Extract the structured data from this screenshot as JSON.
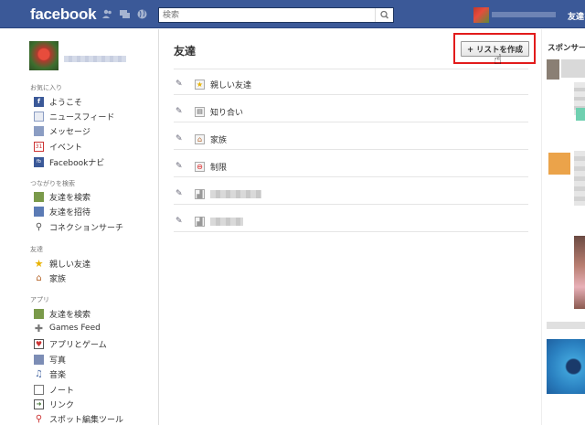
{
  "topbar": {
    "logo": "facebook",
    "search_placeholder": "検索",
    "friends_link": "友達を"
  },
  "sidebar": {
    "sections": [
      {
        "title": "お気に入り",
        "items": [
          {
            "label": "ようこそ",
            "icon": "facebook-f-icon"
          },
          {
            "label": "ニュースフィード",
            "icon": "news-feed-icon"
          },
          {
            "label": "メッセージ",
            "icon": "message-icon"
          },
          {
            "label": "イベント",
            "icon": "calendar-icon"
          },
          {
            "label": "Facebookナビ",
            "icon": "fb-navi-icon"
          }
        ]
      },
      {
        "title": "つながりを検索",
        "items": [
          {
            "label": "友達を検索",
            "icon": "find-friends-icon"
          },
          {
            "label": "友達を招待",
            "icon": "invite-friends-icon"
          },
          {
            "label": "コネクションサーチ",
            "icon": "magnifier-icon"
          }
        ]
      },
      {
        "title": "友達",
        "items": [
          {
            "label": "親しい友達",
            "icon": "star-icon"
          },
          {
            "label": "家族",
            "icon": "house-icon"
          }
        ]
      },
      {
        "title": "アプリ",
        "items": [
          {
            "label": "友達を検索",
            "icon": "find-friends-icon"
          },
          {
            "label": "Games Feed",
            "icon": "games-icon"
          },
          {
            "label": "アプリとゲーム",
            "icon": "apps-icon"
          },
          {
            "label": "写真",
            "icon": "photo-icon"
          },
          {
            "label": "音楽",
            "icon": "music-icon"
          },
          {
            "label": "ノート",
            "icon": "note-icon"
          },
          {
            "label": "リンク",
            "icon": "link-icon"
          },
          {
            "label": "スポット編集ツール",
            "icon": "pin-icon"
          }
        ]
      }
    ]
  },
  "main": {
    "title": "友達",
    "create_list_button": "+ リストを作成",
    "lists": [
      {
        "label": "親しい友達",
        "icon": "star-icon"
      },
      {
        "label": "知り合い",
        "icon": "acquaintance-icon"
      },
      {
        "label": "家族",
        "icon": "house-icon"
      },
      {
        "label": "制限",
        "icon": "restricted-icon"
      }
    ]
  },
  "right": {
    "sponsor_title": "スポンサー"
  },
  "colors": {
    "brand": "#3b5998",
    "highlight": "#e21b1b"
  }
}
